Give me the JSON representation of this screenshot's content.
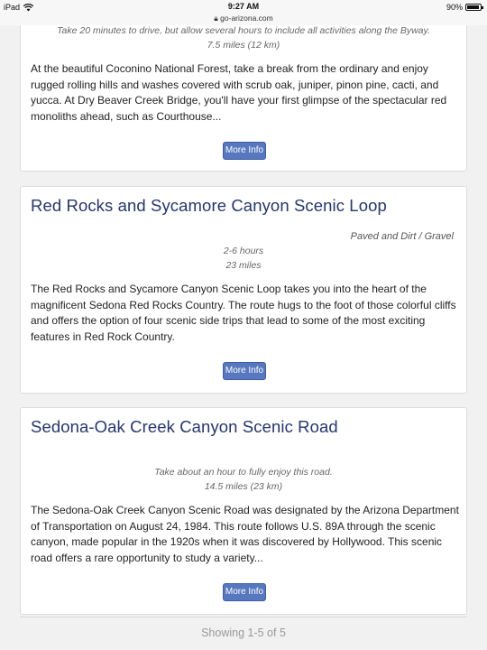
{
  "status_bar": {
    "device": "iPad",
    "time": "9:27 AM",
    "url": "go-arizona.com",
    "battery": "90%",
    "battery_level": 0.9
  },
  "cards": [
    {
      "meta_line1": "Take 20 minutes to drive, but allow several hours to include all activities along the Byway.",
      "meta_line2": "7.5 miles (12 km)",
      "description": "At the beautiful Coconino National Forest, take a break from the ordinary and enjoy rugged rolling hills and washes covered with scrub oak, juniper, pinon pine, cacti, and yucca. At Dry Beaver Creek Bridge, you'll have your first glimpse of the spectacular red monoliths ahead, such as Courthouse...",
      "button": "More Info"
    },
    {
      "title": "Red Rocks and Sycamore Canyon Scenic Loop",
      "road_type": "Paved and Dirt / Gravel",
      "meta_line1": "2-6 hours",
      "meta_line2": "23 miles",
      "description": "The Red Rocks and Sycamore Canyon Scenic Loop takes you into the heart of the magnificent Sedona Red Rocks Country. The route hugs to the foot of those colorful cliffs and offers the option of four scenic side trips that lead to some of the most exciting features in Red Rock Country.",
      "button": "More Info"
    },
    {
      "title": "Sedona-Oak Creek Canyon Scenic Road",
      "meta_line1": "Take about an hour to fully enjoy this road.",
      "meta_line2": "14.5 miles (23 km)",
      "description": "The Sedona-Oak Creek Canyon Scenic Road was designated by the Arizona Department of Transportation on August 24, 1984. This route follows U.S. 89A through the scenic canyon, made popular in the 1920s when it was discovered by Hollywood. This scenic road offers a rare opportunity to study a variety...",
      "button": "More Info"
    }
  ],
  "pagination": {
    "showing": "Showing  1-5 of 5"
  },
  "colors": {
    "title": "#25366b",
    "button": "#5778bf"
  }
}
